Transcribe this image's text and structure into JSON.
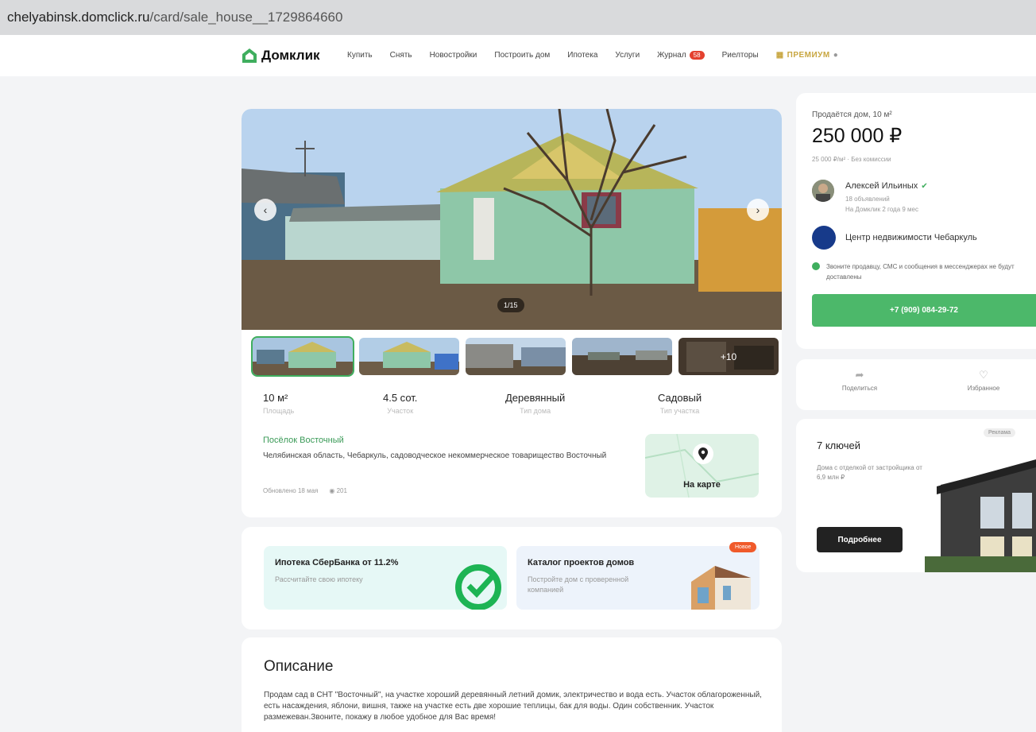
{
  "browser": {
    "url_host": "chelyabinsk.domclick.ru",
    "url_path": "/card/sale_house__1729864660"
  },
  "header": {
    "logo_text": "Домклик",
    "nav": [
      "Купить",
      "Снять",
      "Новостройки",
      "Построить дом",
      "Ипотека",
      "Услуги"
    ],
    "journal_label": "Журнал",
    "journal_badge": "58",
    "realtors_label": "Риелторы",
    "premium_label": "ПРЕМИУМ"
  },
  "gallery": {
    "counter": "1/15",
    "more_photos": "+10"
  },
  "facts": [
    {
      "value": "10 м²",
      "label": "Площадь"
    },
    {
      "value": "4.5 сот.",
      "label": "Участок"
    },
    {
      "value": "Деревянный",
      "label": "Тип дома"
    },
    {
      "value": "Садовый",
      "label": "Тип участка"
    }
  ],
  "address": {
    "title": "Посёлок Восточный",
    "text": "Челябинская область, Чебаркуль, садоводческое некоммерческое товарищество Восточный",
    "updated": "Обновлено 18 мая",
    "views": "201",
    "map_label": "На карте"
  },
  "promo": {
    "a_title": "Ипотека СберБанка от 11.2%",
    "a_sub": "Рассчитайте свою ипотеку",
    "b_title": "Каталог проектов домов",
    "b_sub": "Постройте дом с проверенной компанией",
    "b_badge": "Новое"
  },
  "description": {
    "title": "Описание",
    "text": "Продам сад в СНТ \"Восточный\", на участке хороший деревянный летний домик, электричество и вода есть. Участок облагороженный, есть насаждения, яблони, вишня, также на участке есть две хорошие теплицы, бак для воды. Один собственник. Участок размежеван.Звоните, покажу в любое удобное для Вас время!"
  },
  "sidebar": {
    "listing_type": "Продаётся дом, 10 м²",
    "price": "250 000 ₽",
    "price_per_m": "25 000 ₽/м² · Без комиссии",
    "agent_name": "Алексей Ильиных",
    "agent_ads": "18 объявлений",
    "agent_since": "На Домклик 2 года 9 мес",
    "agency": "Центр недвижимости Чебаркуль",
    "warning": "Звоните продавцу, СМС и сообщения в мессенджерах не будут доставлены",
    "phone": "+7 (909) 084-29-72",
    "share": "Поделиться",
    "favorite": "Избранное"
  },
  "ad": {
    "badge": "Реклама",
    "title": "7 ключей",
    "sub": "Дома с отделкой от застройщика от 6,9 млн ₽",
    "button": "Подробнее"
  },
  "colors": {
    "accent": "#4cb86a",
    "link": "#3a9a57",
    "badge": "#e4412f"
  }
}
